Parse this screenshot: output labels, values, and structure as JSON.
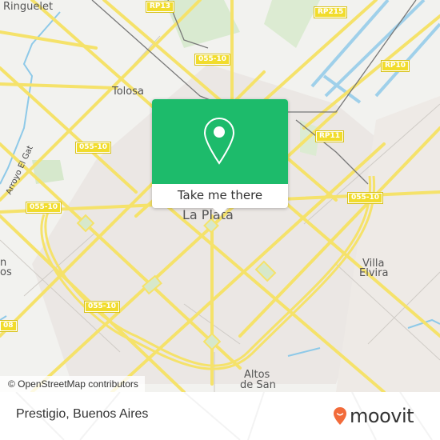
{
  "map": {
    "places": [
      {
        "id": "ringuelet",
        "label": "Ringuelet"
      },
      {
        "id": "tolosa",
        "label": "Tolosa"
      },
      {
        "id": "la-plata",
        "label": "La Plata"
      },
      {
        "id": "villa-elvira-1",
        "label": "Villa"
      },
      {
        "id": "villa-elvira-2",
        "label": "Elvira"
      },
      {
        "id": "altos-1",
        "label": "Altos"
      },
      {
        "id": "altos-2",
        "label": "de San"
      },
      {
        "id": "san-1",
        "label": "n"
      },
      {
        "id": "san-2",
        "label": "os"
      },
      {
        "id": "arroyo",
        "label": "Arroyo El Gat"
      }
    ],
    "shields": [
      {
        "id": "rp13",
        "label": "RP13"
      },
      {
        "id": "rp215",
        "label": "RP215"
      },
      {
        "id": "rp10",
        "label": "RP10"
      },
      {
        "id": "rp11",
        "label": "RP11"
      },
      {
        "id": "r055-10-a",
        "label": "055-10"
      },
      {
        "id": "r055-10-b",
        "label": "055-10"
      },
      {
        "id": "r055-10-c",
        "label": "055-10"
      },
      {
        "id": "r055-10-d",
        "label": "055-10"
      },
      {
        "id": "r055-10-e",
        "label": "055-10"
      },
      {
        "id": "r008",
        "label": "08"
      }
    ],
    "attribution": "© OpenStreetMap contributors"
  },
  "popup": {
    "button_label": "Take me there",
    "color": "#1dbb6b"
  },
  "footer": {
    "title": "Prestigio, Buenos Aires",
    "logo_text": "moovit",
    "logo_color": "#f26b3a"
  }
}
